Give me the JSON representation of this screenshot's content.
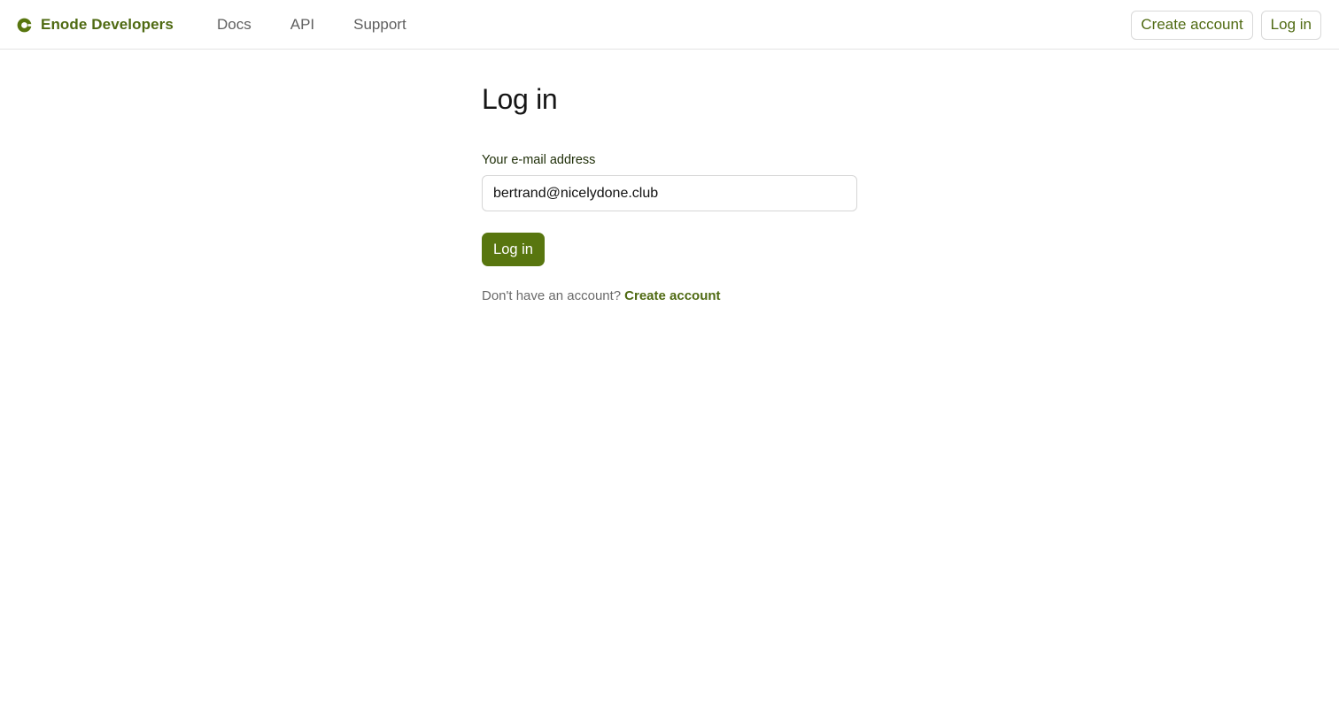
{
  "header": {
    "brand": "Enode Developers",
    "brand_icon": "enode-logo-icon",
    "nav": [
      "Docs",
      "API",
      "Support"
    ],
    "create_account_label": "Create account",
    "login_label": "Log in"
  },
  "main": {
    "title": "Log in",
    "email_label": "Your e-mail address",
    "email_value": "bertrand@nicelydone.club",
    "submit_label": "Log in",
    "signup_prompt": "Don't have an account?",
    "signup_link": "Create account"
  },
  "colors": {
    "brand": "#4f6a12",
    "primary_button": "#58760f"
  }
}
